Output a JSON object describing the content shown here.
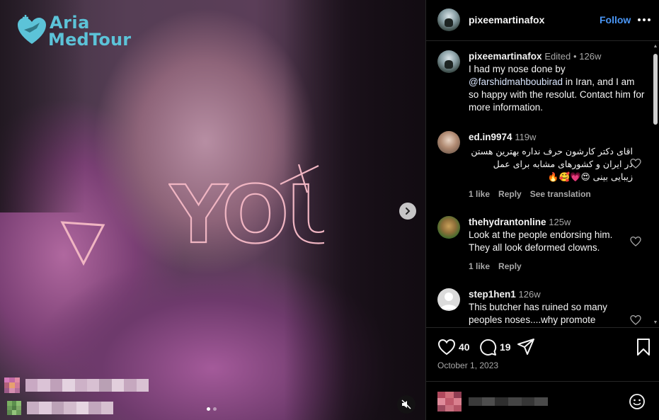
{
  "media": {
    "logo_line1": "Aria",
    "logo_line2": "MedTour",
    "overlay_text": "YOU",
    "carousel_total": 2,
    "carousel_active": 1
  },
  "post": {
    "author": "pixeemartinafox",
    "follow_label": "Follow",
    "caption": {
      "author": "pixeemartinafox",
      "edited": "Edited",
      "separator": "•",
      "time": "126w",
      "text_before": "I had my nose done by ",
      "mention": "@farshidmahboubirad",
      "text_after": " in Iran, and I am so happy with the resolut. Contact him for more information."
    },
    "comments": [
      {
        "user": "ed.in9974",
        "time": "119w",
        "text": "اقای دکتر کارشون حرف نداره بهترین هستن در ایران و کشورهای مشابه برای عمل زیبایی بینی 😍💗🥰🔥",
        "likes": "1 like",
        "reply": "Reply",
        "translate": "See translation"
      },
      {
        "user": "thehydrantonline",
        "time": "125w",
        "text": "Look at the people endorsing him. They all look deformed clowns.",
        "likes": "1 like",
        "reply": "Reply"
      },
      {
        "user": "step1hen1",
        "time": "126w",
        "text": "This butcher has ruined so many peoples noses....why promote"
      }
    ],
    "like_count": "40",
    "comment_count": "19",
    "date": "October 1, 2023"
  },
  "colors": {
    "accent": "#4a96f5",
    "muted": "#a8a8a8",
    "background": "#000000",
    "logo": "#5cc3d8"
  },
  "icons": [
    "heart-icon",
    "comment-icon",
    "share-icon",
    "bookmark-icon",
    "emoji-icon",
    "mute-icon",
    "chevron-right-icon",
    "more-icon"
  ]
}
